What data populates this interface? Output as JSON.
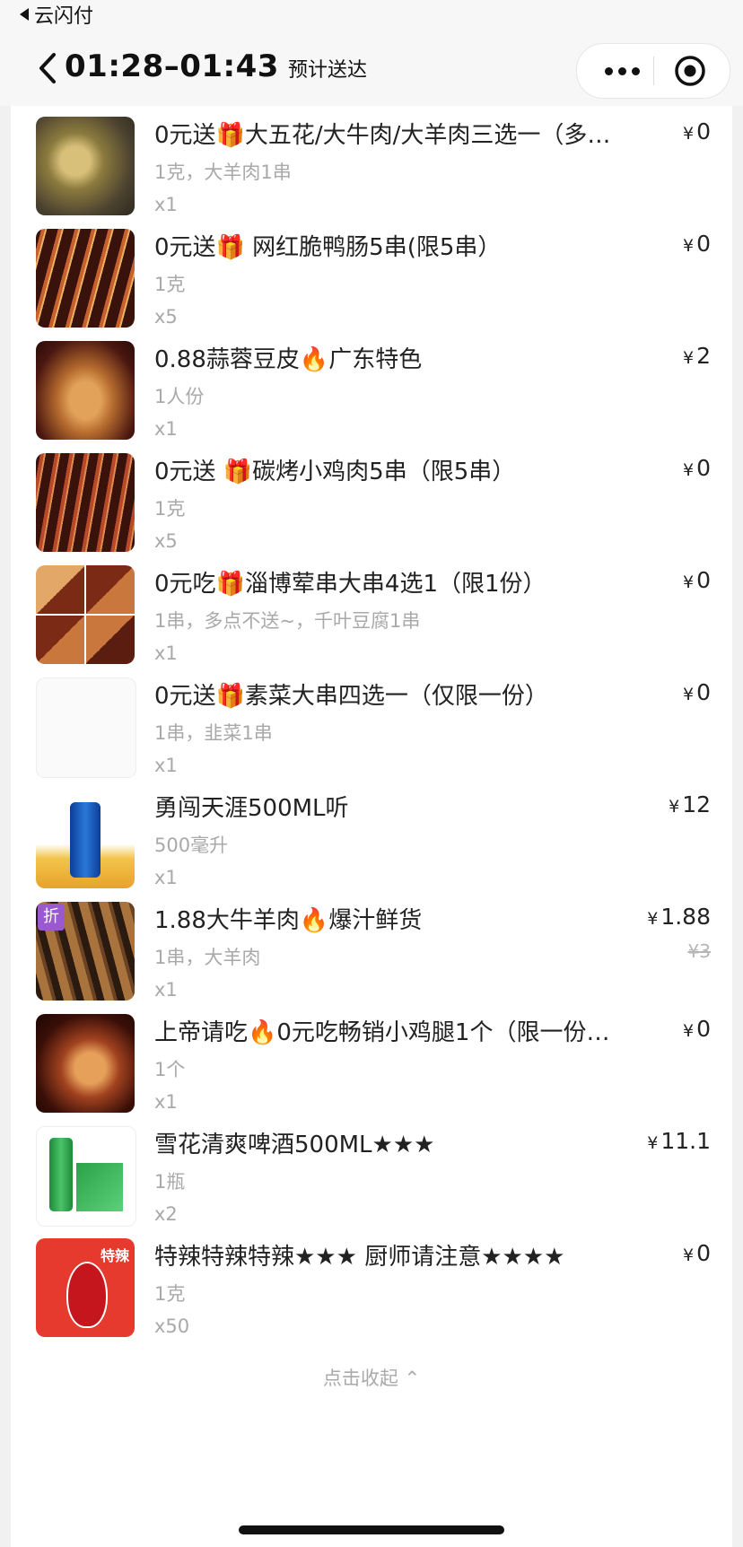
{
  "status": {
    "back_app": "云闪付"
  },
  "nav": {
    "time_range": "01:28–01:43",
    "subtitle": "预计送达"
  },
  "currency": "¥",
  "items": [
    {
      "title": "0元送🎁大五花/大牛肉/大羊肉三选一（多…",
      "spec": "1克，大羊肉1串",
      "qty": "x1",
      "price": "0",
      "image": "fried-meat-photo"
    },
    {
      "title": "0元送🎁 网红脆鸭肠5串(限5串）",
      "spec": "1克",
      "qty": "x5",
      "price": "0",
      "image": "skewers-photo"
    },
    {
      "title": "0.88蒜蓉豆皮🔥广东特色",
      "spec": "1人份",
      "qty": "x1",
      "price": "2",
      "image": "tofu-skin-photo"
    },
    {
      "title": "0元送 🎁碳烤小鸡肉5串（限5串）",
      "spec": "1克",
      "qty": "x5",
      "price": "0",
      "image": "chicken-skewers-photo"
    },
    {
      "title": "0元吃🎁淄博荤串大串4选1（限1份）",
      "spec": "1串，多点不送~，千叶豆腐1串",
      "qty": "x1",
      "price": "0",
      "image": "skewer-collage-photo"
    },
    {
      "title": "0元送🎁素菜大串四选一（仅限一份）",
      "spec": "1串，韭菜1串",
      "qty": "x1",
      "price": "0",
      "image": "blank-photo"
    },
    {
      "title": "勇闯天涯500ML听",
      "spec": "500毫升",
      "qty": "x1",
      "price": "12",
      "image": "beer-can-photo"
    },
    {
      "title": "1.88大牛羊肉🔥爆汁鲜货",
      "spec": "1串，大羊肉",
      "qty": "x1",
      "price": "1.88",
      "original_price": "¥3",
      "badge": "折",
      "image": "lamb-skewers-photo"
    },
    {
      "title": "上帝请吃🔥0元吃畅销小鸡腿1个（限一份多…",
      "spec": "1个",
      "qty": "x1",
      "price": "0",
      "image": "chicken-leg-photo"
    },
    {
      "title": "雪花清爽啤酒500ML★★★",
      "spec": "1瓶",
      "qty": "x2",
      "price": "11.1",
      "image": "snow-beer-photo"
    },
    {
      "title": "特辣特辣特辣★★★ 厨师请注意★★★★",
      "spec": "1克",
      "qty": "x50",
      "price": "0",
      "image": "chili-mascot-photo",
      "image_label": "特辣"
    }
  ],
  "collapse_label": "点击收起 ⌃",
  "colors": {
    "badge": "#9b59d0",
    "muted": "#a9a9a9",
    "text": "#222222"
  }
}
